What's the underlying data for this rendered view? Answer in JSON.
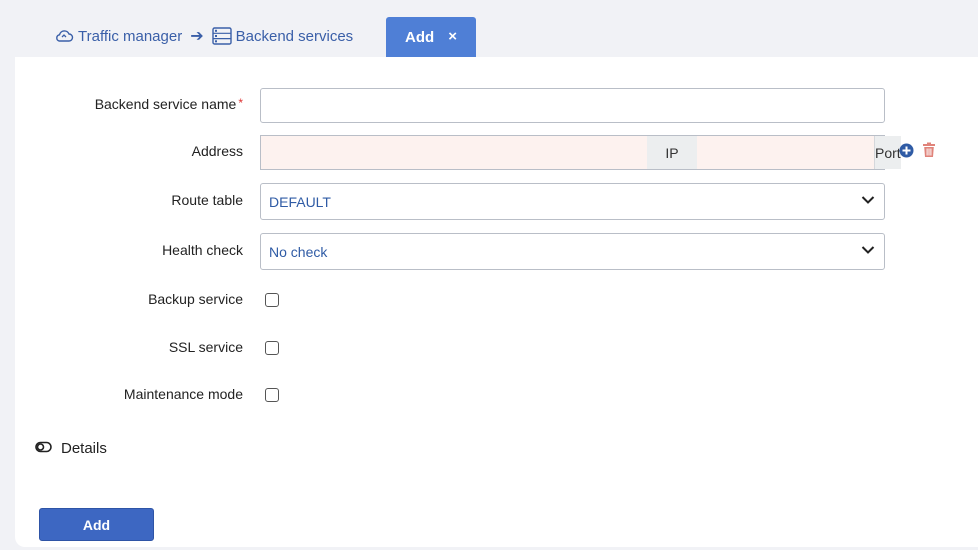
{
  "breadcrumb": {
    "items": [
      {
        "label": "Traffic manager",
        "icon": "cloud-icon"
      },
      {
        "label": "Backend services",
        "icon": "server-list-icon"
      }
    ]
  },
  "tab": {
    "label": "Add",
    "close_glyph": "×"
  },
  "form": {
    "name_label": "Backend service name",
    "name_required": "*",
    "name_value": "",
    "address_label": "Address",
    "ip_addon": "IP",
    "port_addon": "Port",
    "ip_value": "",
    "port_value": "",
    "route_label": "Route table",
    "route_value": "DEFAULT",
    "health_label": "Health check",
    "health_value": "No check",
    "backup_label": "Backup service",
    "ssl_label": "SSL service",
    "maintenance_label": "Maintenance mode"
  },
  "details": {
    "label": "Details"
  },
  "actions": {
    "add_label": "Add"
  },
  "colors": {
    "accent": "#4f7fd6",
    "button": "#3d67c2",
    "link": "#3a5fa8",
    "error_bg": "#fdf2ef",
    "delete": "#e0837a"
  }
}
